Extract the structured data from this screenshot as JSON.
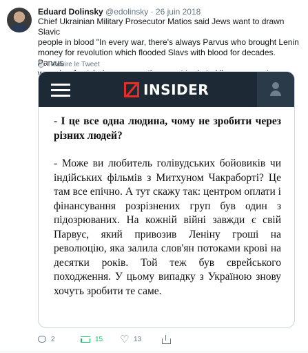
{
  "tweet": {
    "author_name": "Eduard Dolinsky",
    "author_handle": "@edolinsky",
    "separator": "·",
    "date": "26 juin 2018",
    "text_lines": [
      "Chief Ukrainian Military Prosecutor Matios said Jews want to drawn Slavic",
      "people in blood \"In every war, there's always Parvus who brought Lenin",
      "money for revolution which flooded Slavs with blood for decades. Parvus",
      "was also Jewish. In our case, they want to do to Ukr same again"
    ],
    "translate_label": "Traduire le Tweet",
    "translate_icon": "globe-icon"
  },
  "media": {
    "site_logo_text": "INSIDER",
    "brand_color": "#e52d27",
    "bar_color": "#1d2a35",
    "menu_icon": "hamburger-menu-icon",
    "user_icon": "user-icon",
    "question": "- І це все одна людина, чому не зробити через різних людей?",
    "answer": "- Може ви любитель голівудських бойовиків чи індійських фільмів з Митхуном Чакраборті? Це там все епічно. А тут скажу так: центром оплати і фінансування розрізнених груп був один з підозрюваних. На кожній війні завжди є свій Парвус, який привозив Леніну гроші на революцію, яка залила слов'ян потоками крові на десятки років. Той теж був єврейського походження. У цьому випадку з Україною знову хочуть зробити те саме."
  },
  "actions": {
    "reply_count": "2",
    "retweet_count": "15",
    "like_count": "13",
    "retweet_color": "#17bf63",
    "icons": [
      "reply-icon",
      "retweet-icon",
      "heart-icon",
      "share-icon"
    ]
  }
}
